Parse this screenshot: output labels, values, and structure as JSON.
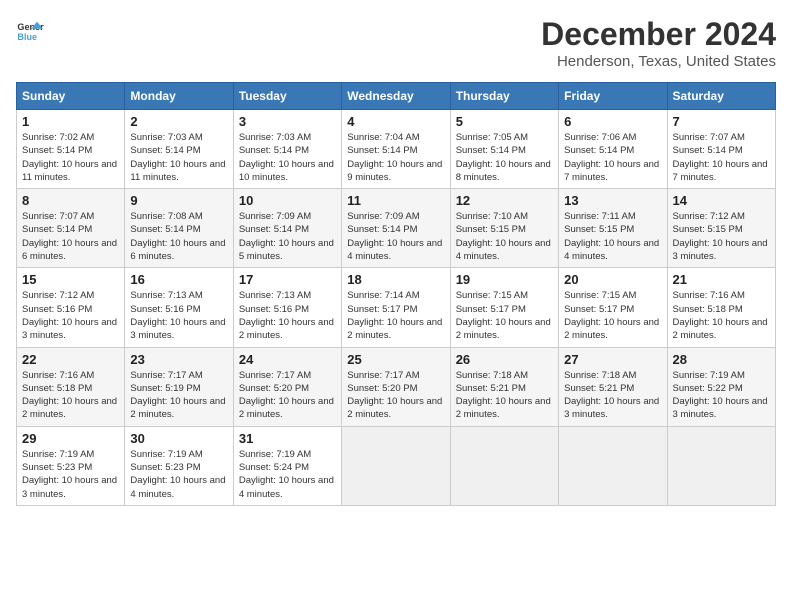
{
  "logo": {
    "line1": "General",
    "line2": "Blue"
  },
  "title": "December 2024",
  "subtitle": "Henderson, Texas, United States",
  "days_of_week": [
    "Sunday",
    "Monday",
    "Tuesday",
    "Wednesday",
    "Thursday",
    "Friday",
    "Saturday"
  ],
  "weeks": [
    [
      {
        "day": 1,
        "sunrise": "7:02 AM",
        "sunset": "5:14 PM",
        "daylight": "10 hours and 11 minutes."
      },
      {
        "day": 2,
        "sunrise": "7:03 AM",
        "sunset": "5:14 PM",
        "daylight": "10 hours and 11 minutes."
      },
      {
        "day": 3,
        "sunrise": "7:03 AM",
        "sunset": "5:14 PM",
        "daylight": "10 hours and 10 minutes."
      },
      {
        "day": 4,
        "sunrise": "7:04 AM",
        "sunset": "5:14 PM",
        "daylight": "10 hours and 9 minutes."
      },
      {
        "day": 5,
        "sunrise": "7:05 AM",
        "sunset": "5:14 PM",
        "daylight": "10 hours and 8 minutes."
      },
      {
        "day": 6,
        "sunrise": "7:06 AM",
        "sunset": "5:14 PM",
        "daylight": "10 hours and 7 minutes."
      },
      {
        "day": 7,
        "sunrise": "7:07 AM",
        "sunset": "5:14 PM",
        "daylight": "10 hours and 7 minutes."
      }
    ],
    [
      {
        "day": 8,
        "sunrise": "7:07 AM",
        "sunset": "5:14 PM",
        "daylight": "10 hours and 6 minutes."
      },
      {
        "day": 9,
        "sunrise": "7:08 AM",
        "sunset": "5:14 PM",
        "daylight": "10 hours and 6 minutes."
      },
      {
        "day": 10,
        "sunrise": "7:09 AM",
        "sunset": "5:14 PM",
        "daylight": "10 hours and 5 minutes."
      },
      {
        "day": 11,
        "sunrise": "7:09 AM",
        "sunset": "5:14 PM",
        "daylight": "10 hours and 4 minutes."
      },
      {
        "day": 12,
        "sunrise": "7:10 AM",
        "sunset": "5:15 PM",
        "daylight": "10 hours and 4 minutes."
      },
      {
        "day": 13,
        "sunrise": "7:11 AM",
        "sunset": "5:15 PM",
        "daylight": "10 hours and 4 minutes."
      },
      {
        "day": 14,
        "sunrise": "7:12 AM",
        "sunset": "5:15 PM",
        "daylight": "10 hours and 3 minutes."
      }
    ],
    [
      {
        "day": 15,
        "sunrise": "7:12 AM",
        "sunset": "5:16 PM",
        "daylight": "10 hours and 3 minutes."
      },
      {
        "day": 16,
        "sunrise": "7:13 AM",
        "sunset": "5:16 PM",
        "daylight": "10 hours and 3 minutes."
      },
      {
        "day": 17,
        "sunrise": "7:13 AM",
        "sunset": "5:16 PM",
        "daylight": "10 hours and 2 minutes."
      },
      {
        "day": 18,
        "sunrise": "7:14 AM",
        "sunset": "5:17 PM",
        "daylight": "10 hours and 2 minutes."
      },
      {
        "day": 19,
        "sunrise": "7:15 AM",
        "sunset": "5:17 PM",
        "daylight": "10 hours and 2 minutes."
      },
      {
        "day": 20,
        "sunrise": "7:15 AM",
        "sunset": "5:17 PM",
        "daylight": "10 hours and 2 minutes."
      },
      {
        "day": 21,
        "sunrise": "7:16 AM",
        "sunset": "5:18 PM",
        "daylight": "10 hours and 2 minutes."
      }
    ],
    [
      {
        "day": 22,
        "sunrise": "7:16 AM",
        "sunset": "5:18 PM",
        "daylight": "10 hours and 2 minutes."
      },
      {
        "day": 23,
        "sunrise": "7:17 AM",
        "sunset": "5:19 PM",
        "daylight": "10 hours and 2 minutes."
      },
      {
        "day": 24,
        "sunrise": "7:17 AM",
        "sunset": "5:20 PM",
        "daylight": "10 hours and 2 minutes."
      },
      {
        "day": 25,
        "sunrise": "7:17 AM",
        "sunset": "5:20 PM",
        "daylight": "10 hours and 2 minutes."
      },
      {
        "day": 26,
        "sunrise": "7:18 AM",
        "sunset": "5:21 PM",
        "daylight": "10 hours and 2 minutes."
      },
      {
        "day": 27,
        "sunrise": "7:18 AM",
        "sunset": "5:21 PM",
        "daylight": "10 hours and 3 minutes."
      },
      {
        "day": 28,
        "sunrise": "7:19 AM",
        "sunset": "5:22 PM",
        "daylight": "10 hours and 3 minutes."
      }
    ],
    [
      {
        "day": 29,
        "sunrise": "7:19 AM",
        "sunset": "5:23 PM",
        "daylight": "10 hours and 3 minutes."
      },
      {
        "day": 30,
        "sunrise": "7:19 AM",
        "sunset": "5:23 PM",
        "daylight": "10 hours and 4 minutes."
      },
      {
        "day": 31,
        "sunrise": "7:19 AM",
        "sunset": "5:24 PM",
        "daylight": "10 hours and 4 minutes."
      },
      null,
      null,
      null,
      null
    ]
  ]
}
